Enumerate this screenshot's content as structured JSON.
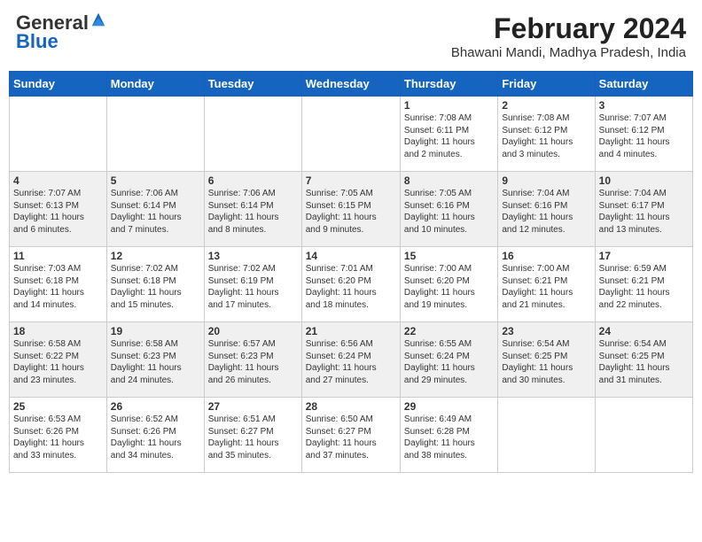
{
  "header": {
    "logo_general": "General",
    "logo_blue": "Blue",
    "month_year": "February 2024",
    "location": "Bhawani Mandi, Madhya Pradesh, India"
  },
  "days_of_week": [
    "Sunday",
    "Monday",
    "Tuesday",
    "Wednesday",
    "Thursday",
    "Friday",
    "Saturday"
  ],
  "weeks": [
    [
      {
        "day": "",
        "info": ""
      },
      {
        "day": "",
        "info": ""
      },
      {
        "day": "",
        "info": ""
      },
      {
        "day": "",
        "info": ""
      },
      {
        "day": "1",
        "info": "Sunrise: 7:08 AM\nSunset: 6:11 PM\nDaylight: 11 hours\nand 2 minutes."
      },
      {
        "day": "2",
        "info": "Sunrise: 7:08 AM\nSunset: 6:12 PM\nDaylight: 11 hours\nand 3 minutes."
      },
      {
        "day": "3",
        "info": "Sunrise: 7:07 AM\nSunset: 6:12 PM\nDaylight: 11 hours\nand 4 minutes."
      }
    ],
    [
      {
        "day": "4",
        "info": "Sunrise: 7:07 AM\nSunset: 6:13 PM\nDaylight: 11 hours\nand 6 minutes."
      },
      {
        "day": "5",
        "info": "Sunrise: 7:06 AM\nSunset: 6:14 PM\nDaylight: 11 hours\nand 7 minutes."
      },
      {
        "day": "6",
        "info": "Sunrise: 7:06 AM\nSunset: 6:14 PM\nDaylight: 11 hours\nand 8 minutes."
      },
      {
        "day": "7",
        "info": "Sunrise: 7:05 AM\nSunset: 6:15 PM\nDaylight: 11 hours\nand 9 minutes."
      },
      {
        "day": "8",
        "info": "Sunrise: 7:05 AM\nSunset: 6:16 PM\nDaylight: 11 hours\nand 10 minutes."
      },
      {
        "day": "9",
        "info": "Sunrise: 7:04 AM\nSunset: 6:16 PM\nDaylight: 11 hours\nand 12 minutes."
      },
      {
        "day": "10",
        "info": "Sunrise: 7:04 AM\nSunset: 6:17 PM\nDaylight: 11 hours\nand 13 minutes."
      }
    ],
    [
      {
        "day": "11",
        "info": "Sunrise: 7:03 AM\nSunset: 6:18 PM\nDaylight: 11 hours\nand 14 minutes."
      },
      {
        "day": "12",
        "info": "Sunrise: 7:02 AM\nSunset: 6:18 PM\nDaylight: 11 hours\nand 15 minutes."
      },
      {
        "day": "13",
        "info": "Sunrise: 7:02 AM\nSunset: 6:19 PM\nDaylight: 11 hours\nand 17 minutes."
      },
      {
        "day": "14",
        "info": "Sunrise: 7:01 AM\nSunset: 6:20 PM\nDaylight: 11 hours\nand 18 minutes."
      },
      {
        "day": "15",
        "info": "Sunrise: 7:00 AM\nSunset: 6:20 PM\nDaylight: 11 hours\nand 19 minutes."
      },
      {
        "day": "16",
        "info": "Sunrise: 7:00 AM\nSunset: 6:21 PM\nDaylight: 11 hours\nand 21 minutes."
      },
      {
        "day": "17",
        "info": "Sunrise: 6:59 AM\nSunset: 6:21 PM\nDaylight: 11 hours\nand 22 minutes."
      }
    ],
    [
      {
        "day": "18",
        "info": "Sunrise: 6:58 AM\nSunset: 6:22 PM\nDaylight: 11 hours\nand 23 minutes."
      },
      {
        "day": "19",
        "info": "Sunrise: 6:58 AM\nSunset: 6:23 PM\nDaylight: 11 hours\nand 24 minutes."
      },
      {
        "day": "20",
        "info": "Sunrise: 6:57 AM\nSunset: 6:23 PM\nDaylight: 11 hours\nand 26 minutes."
      },
      {
        "day": "21",
        "info": "Sunrise: 6:56 AM\nSunset: 6:24 PM\nDaylight: 11 hours\nand 27 minutes."
      },
      {
        "day": "22",
        "info": "Sunrise: 6:55 AM\nSunset: 6:24 PM\nDaylight: 11 hours\nand 29 minutes."
      },
      {
        "day": "23",
        "info": "Sunrise: 6:54 AM\nSunset: 6:25 PM\nDaylight: 11 hours\nand 30 minutes."
      },
      {
        "day": "24",
        "info": "Sunrise: 6:54 AM\nSunset: 6:25 PM\nDaylight: 11 hours\nand 31 minutes."
      }
    ],
    [
      {
        "day": "25",
        "info": "Sunrise: 6:53 AM\nSunset: 6:26 PM\nDaylight: 11 hours\nand 33 minutes."
      },
      {
        "day": "26",
        "info": "Sunrise: 6:52 AM\nSunset: 6:26 PM\nDaylight: 11 hours\nand 34 minutes."
      },
      {
        "day": "27",
        "info": "Sunrise: 6:51 AM\nSunset: 6:27 PM\nDaylight: 11 hours\nand 35 minutes."
      },
      {
        "day": "28",
        "info": "Sunrise: 6:50 AM\nSunset: 6:27 PM\nDaylight: 11 hours\nand 37 minutes."
      },
      {
        "day": "29",
        "info": "Sunrise: 6:49 AM\nSunset: 6:28 PM\nDaylight: 11 hours\nand 38 minutes."
      },
      {
        "day": "",
        "info": ""
      },
      {
        "day": "",
        "info": ""
      }
    ]
  ]
}
